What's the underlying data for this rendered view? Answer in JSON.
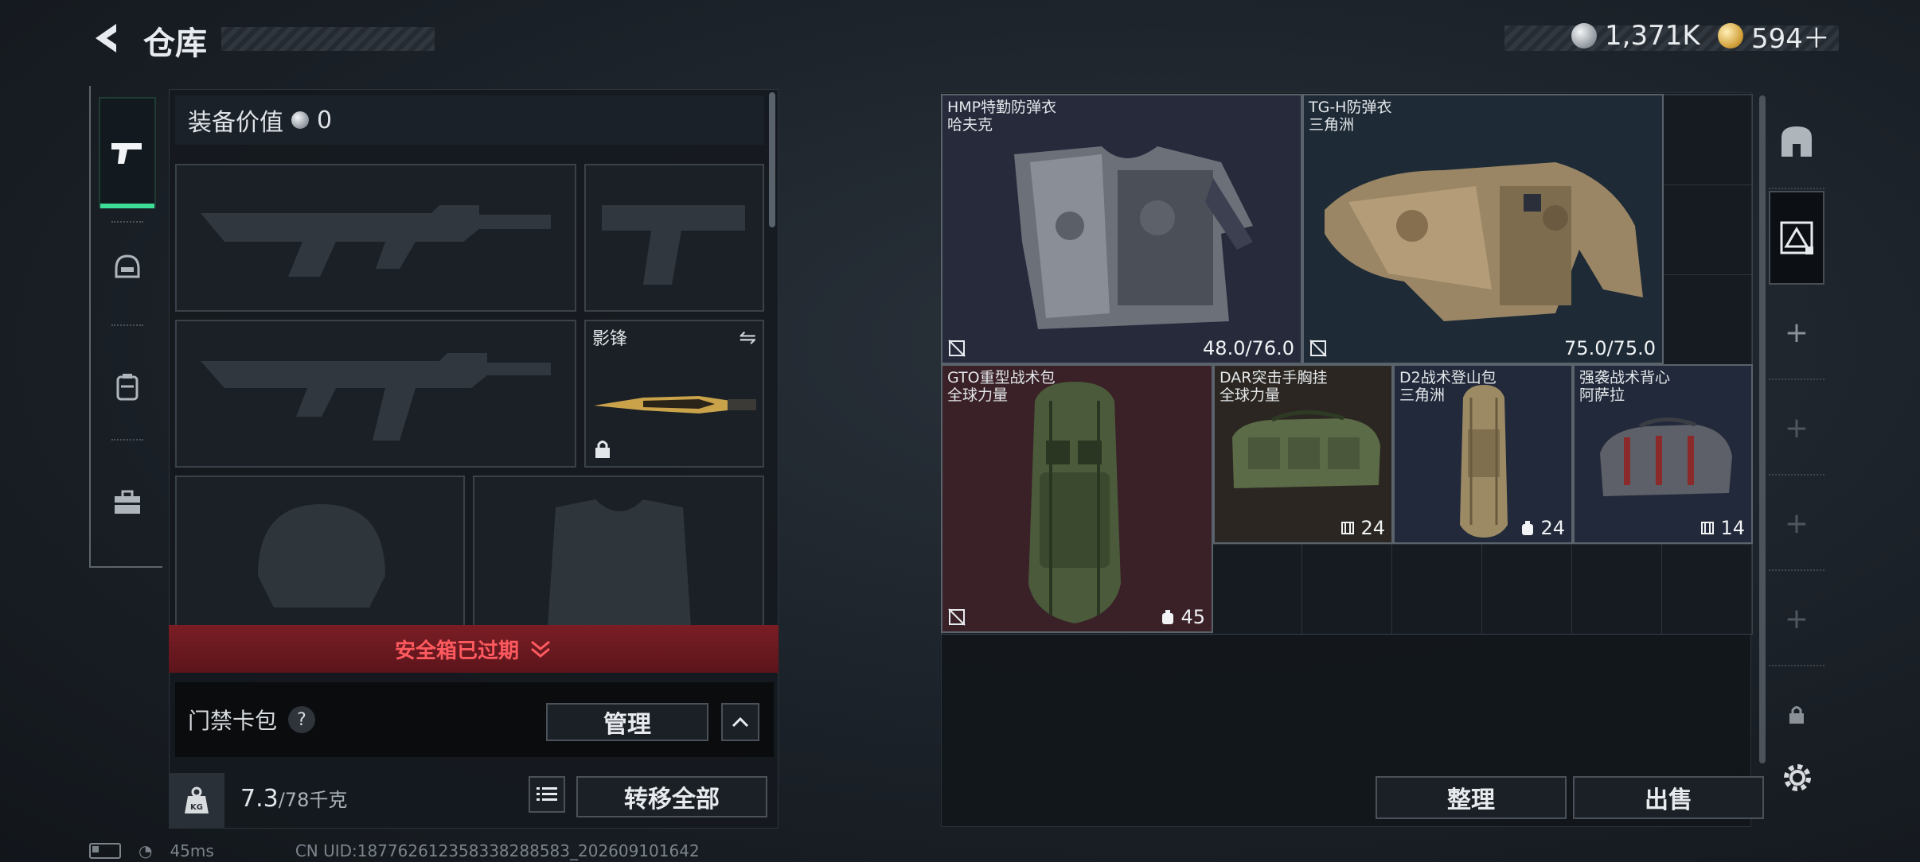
{
  "header": {
    "title": "仓库"
  },
  "currency": {
    "silver": "1,371K",
    "gold": "594＋"
  },
  "tabs": [
    {
      "name": "pistol-icon"
    },
    {
      "name": "helmet-icon"
    },
    {
      "name": "backpack-icon"
    },
    {
      "name": "toolbox-icon"
    }
  ],
  "loadout": {
    "equip_value_label": "装备价值",
    "equip_value": "0",
    "melee_slot_label": "影锋",
    "safebox_status": "安全箱已过期",
    "keybag_label": "门禁卡包",
    "help_symbol": "?",
    "manage_label": "管理",
    "weight_current": "7.3",
    "weight_max": "/78千克",
    "weight_badge": "KG",
    "transfer_all_label": "转移全部"
  },
  "storage": {
    "items": [
      {
        "title": "HMP特勤防弹衣",
        "maker": "哈夫克",
        "stat": "48.0/76.0"
      },
      {
        "title": "TG-H防弹衣",
        "maker": "三角洲",
        "stat": "75.0/75.0"
      },
      {
        "title": "GTO重型战术包",
        "maker": "全球力量",
        "stat": "45"
      },
      {
        "title": "DAR突击手胸挂",
        "maker": "全球力量",
        "stat": "24"
      },
      {
        "title": "D2战术登山包",
        "maker": "三角洲",
        "stat": "24"
      },
      {
        "title": "强袭战术背心",
        "maker": "阿萨拉",
        "stat": "14"
      }
    ],
    "sort_label": "整理",
    "sell_label": "出售"
  },
  "status": {
    "ping": "45ms",
    "uid": "CN UID:187762612358338288583_202609101642"
  },
  "colors": {
    "accent_green": "#3ddc97",
    "warning_red": "#ff5a5f",
    "gto_bg": "#3a2027"
  }
}
